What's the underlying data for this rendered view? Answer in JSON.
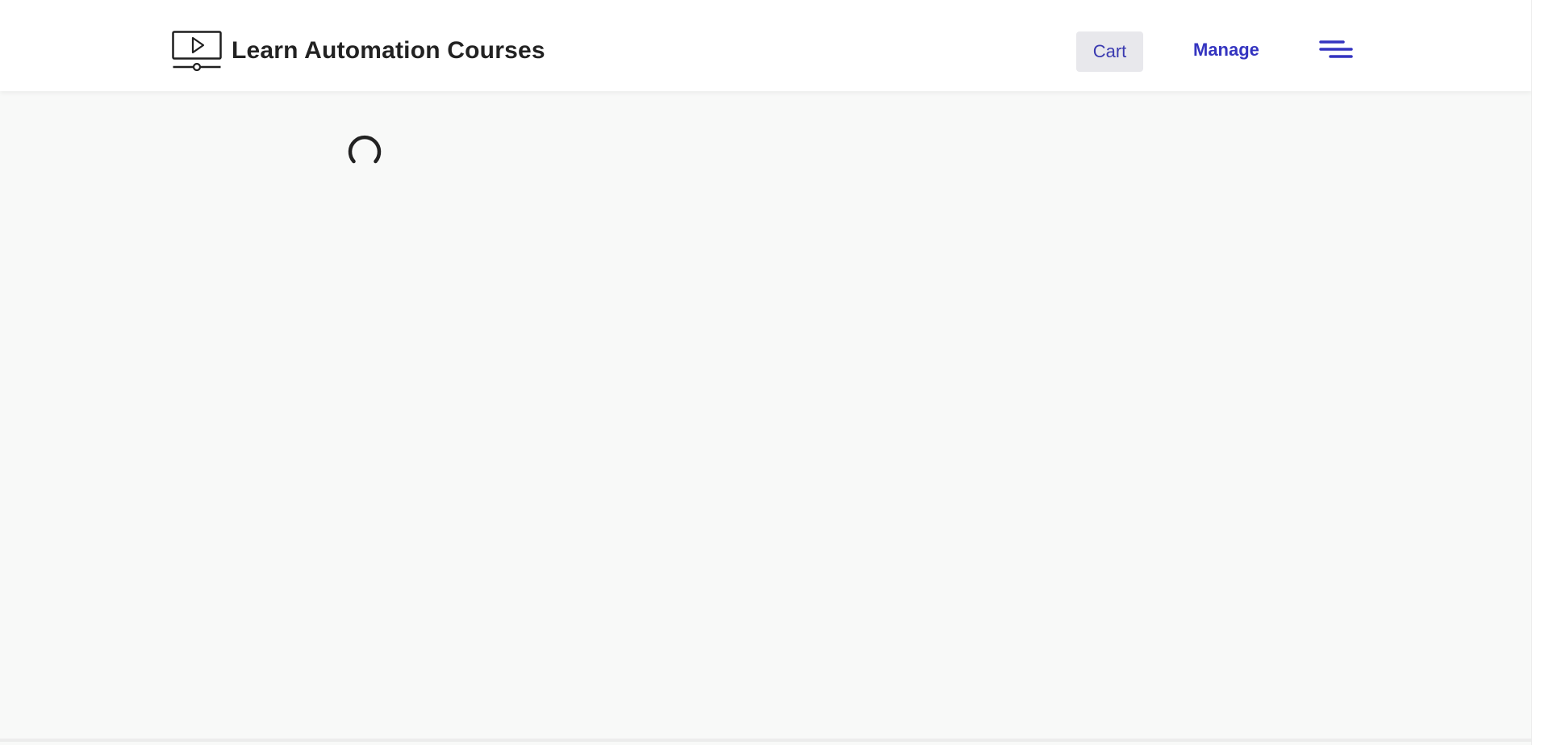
{
  "header": {
    "brand": {
      "name": "Learn Automation Courses",
      "logo_icon": "video-player-icon"
    },
    "nav": {
      "cart_label": "Cart",
      "manage_label": "Manage",
      "menu_icon": "hamburger-menu-icon"
    }
  },
  "main": {
    "loading_icon": "loading-spinner-icon"
  },
  "colors": {
    "header_bg": "#ffffff",
    "page_bg": "#f8f9f8",
    "accent": "#3434c0",
    "cart_bg": "#e8e8ec",
    "text_dark": "#222222"
  }
}
